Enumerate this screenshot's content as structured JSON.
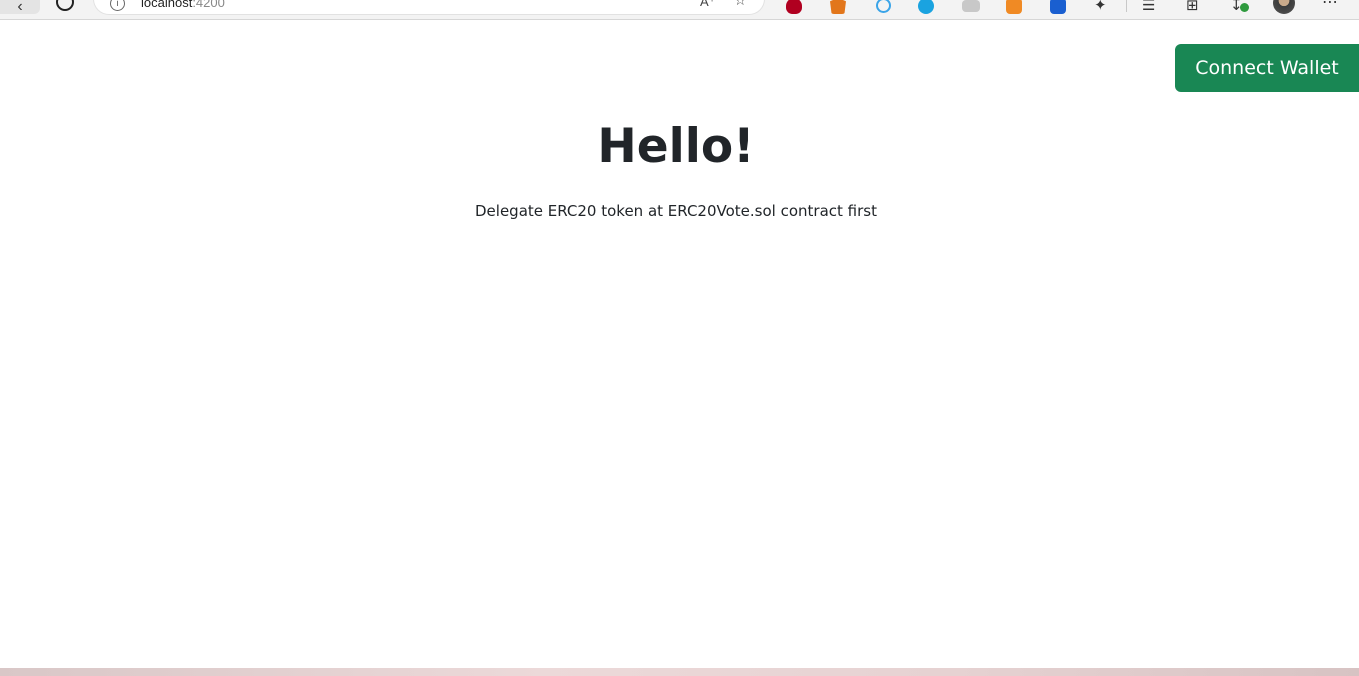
{
  "browser": {
    "url_host": "localhost",
    "url_port": ":4200",
    "read_aloud_icon": "read-aloud-icon",
    "extensions": [
      "shield-extension-icon",
      "metamask-fox-icon",
      "extension-icon",
      "extension-icon",
      "extension-icon",
      "extension-icon",
      "extension-icon",
      "puzzle-icon"
    ]
  },
  "header": {
    "connect_label": "Connect Wallet",
    "connect_color": "#198754"
  },
  "main": {
    "title": "Hello!",
    "subtitle": "Delegate ERC20 token at ERC20Vote.sol contract first"
  }
}
